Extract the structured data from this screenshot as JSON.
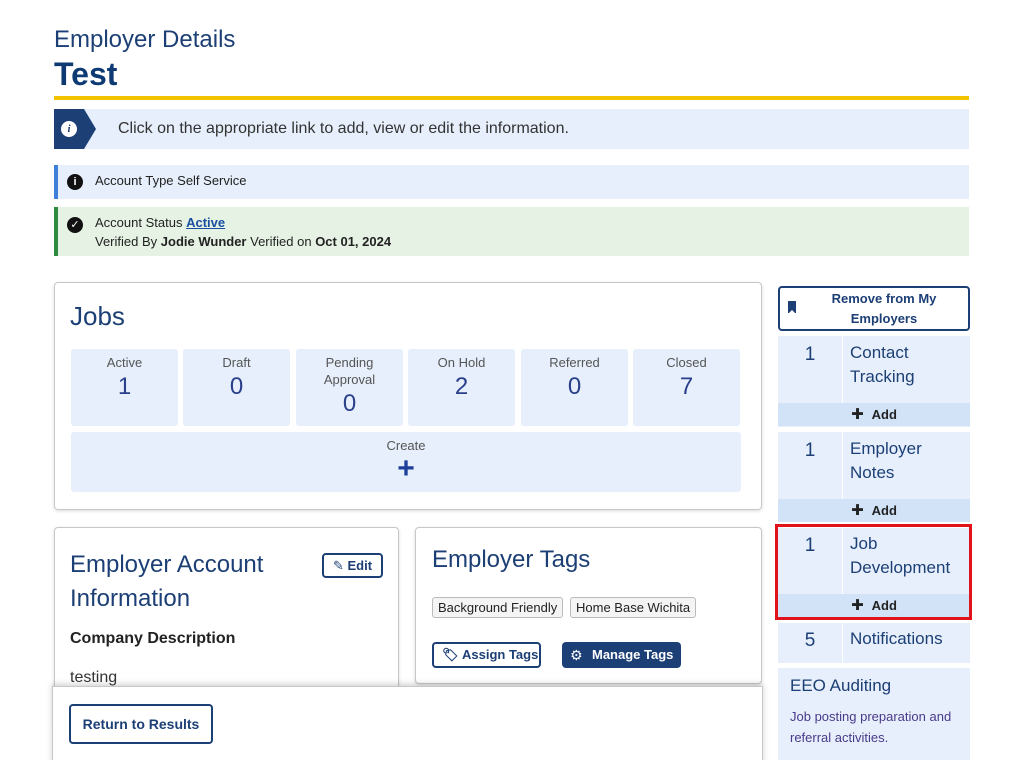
{
  "header": {
    "subtitle": "Employer Details",
    "title": "Test"
  },
  "info_banner": {
    "text": "Click on the appropriate link to add, view or edit the information."
  },
  "account_type": {
    "text": "Account Type Self Service"
  },
  "account_status": {
    "label": "Account Status",
    "status_link": "Active",
    "verified_by_label": "Verified By",
    "verified_by": "Jodie Wunder",
    "verified_on_label": "Verified on",
    "verified_on": "Oct 01, 2024"
  },
  "jobs": {
    "title": "Jobs",
    "stats": [
      {
        "label": "Active",
        "value": "1"
      },
      {
        "label": "Draft",
        "value": "0"
      },
      {
        "label": "Pending Approval",
        "value": "0"
      },
      {
        "label": "On Hold",
        "value": "2"
      },
      {
        "label": "Referred",
        "value": "0"
      },
      {
        "label": "Closed",
        "value": "7"
      }
    ],
    "create_label": "Create",
    "create_icon": "+"
  },
  "account_info": {
    "title": "Employer Account Information",
    "edit_label": "Edit",
    "company_description_label": "Company Description",
    "company_description": "testing"
  },
  "tags": {
    "title": "Employer Tags",
    "items": [
      "Background Friendly",
      "Home Base Wichita"
    ],
    "assign_label": "Assign Tags",
    "manage_label": "Manage Tags"
  },
  "footer": {
    "return_label": "Return to Results"
  },
  "sidebar": {
    "remove_label": "Remove from My Employers",
    "add_label": "Add",
    "items": [
      {
        "count": "1",
        "label": "Contact Tracking"
      },
      {
        "count": "1",
        "label": "Employer Notes"
      },
      {
        "count": "1",
        "label": "Job Development"
      },
      {
        "count": "5",
        "label": "Notifications"
      }
    ],
    "eeo": {
      "title": "EEO Auditing",
      "description": "Job posting preparation and referral activities."
    }
  },
  "colors": {
    "brand_navy": "#1c3f75",
    "gold_rule": "#f2c300",
    "highlight_red": "#e0121b",
    "panel_blue": "#e6effb",
    "success_green": "#2e8a3e"
  },
  "icons": {
    "info_banner": "info-icon",
    "account_type": "info-circle-icon",
    "account_status": "check-circle-icon",
    "edit": "pencil-icon",
    "assign_tags": "tag-icon",
    "manage_tags": "gear-icon",
    "remove": "bookmark-icon",
    "add": "plus-icon"
  }
}
